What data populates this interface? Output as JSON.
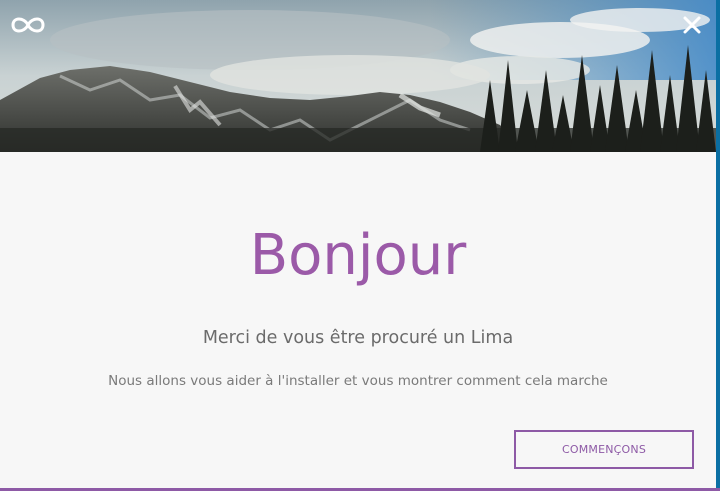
{
  "window": {
    "close_icon": "close-icon",
    "logo_icon": "infinity-logo-icon"
  },
  "welcome": {
    "title": "Bonjour",
    "subtitle": "Merci de vous être procuré un Lima",
    "description": "Nous allons vous aider à l'installer et vous montrer comment cela marche",
    "start_button_label": "COMMENÇONS"
  },
  "colors": {
    "accent": "#8e5aa6",
    "title": "#9b5aa8",
    "background": "#f7f7f7",
    "frame": "#1d84b8"
  }
}
